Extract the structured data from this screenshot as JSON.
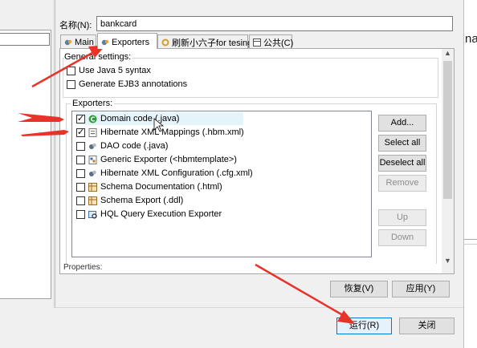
{
  "name_row": {
    "label": "名称(N):",
    "value": "bankcard"
  },
  "tabs": [
    {
      "label": "Main",
      "icon": "main-tab-icon"
    },
    {
      "label": "Exporters",
      "icon": "exporters-tab-icon"
    },
    {
      "label": "刷新小六子for tesing",
      "icon": "refresh-tab-icon"
    },
    {
      "label": "公共(C)",
      "icon": "common-tab-icon"
    }
  ],
  "general": {
    "label": "General settings:",
    "use_java5": {
      "label": "Use Java 5 syntax",
      "checked": false
    },
    "ejb3": {
      "label": "Generate EJB3 annotations",
      "checked": false
    }
  },
  "exporters": {
    "label": "Exporters:",
    "items": [
      {
        "label": "Domain code (.java)",
        "checked": true,
        "icon": "java-class-icon"
      },
      {
        "label": "Hibernate XML Mappings (.hbm.xml)",
        "checked": true,
        "icon": "xml-file-icon"
      },
      {
        "label": "DAO code (.java)",
        "checked": false,
        "icon": "hibernate-icon"
      },
      {
        "label": "Generic Exporter (<hbmtemplate>)",
        "checked": false,
        "icon": "generic-exporter-icon"
      },
      {
        "label": "Hibernate XML Configuration (.cfg.xml)",
        "checked": false,
        "icon": "hibernate-icon"
      },
      {
        "label": "Schema Documentation (.html)",
        "checked": false,
        "icon": "schema-doc-icon"
      },
      {
        "label": "Schema Export (.ddl)",
        "checked": false,
        "icon": "schema-export-icon"
      },
      {
        "label": "HQL Query Execution Exporter",
        "checked": false,
        "icon": "hql-icon"
      }
    ],
    "buttons": {
      "add": "Add...",
      "select_all": "Select all",
      "deselect_all": "Deselect all",
      "remove": "Remove",
      "up": "Up",
      "down": "Down"
    }
  },
  "properties_fragment": "Properties:",
  "panel_buttons": {
    "revert": "恢复(V)",
    "apply": "应用(Y)"
  },
  "dialog_buttons": {
    "run": "运行(R)",
    "close": "关闭"
  },
  "background_window_fragment": "na",
  "colors": {
    "arrow": "#e8332a",
    "java_icon": "#2e9c3a",
    "focus_border": "#0078d7"
  }
}
